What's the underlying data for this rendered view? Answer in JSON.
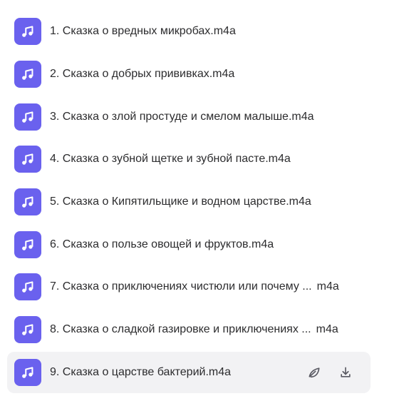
{
  "colors": {
    "icon_background": "#6a61ee",
    "selected_row_background": "#f2f2f4",
    "text": "#2c2c2e",
    "action_icon": "#5a5a63"
  },
  "files": [
    {
      "base": "1. Сказка о вредных микробах",
      "ext": ".m4a",
      "truncated": false
    },
    {
      "base": "2. Сказка о добрых прививках",
      "ext": ".m4a",
      "truncated": false
    },
    {
      "base": "3. Сказка о злой простуде и смелом малыше",
      "ext": ".m4a",
      "truncated": false
    },
    {
      "base": "4. Сказка о зубной щетке и зубной пасте",
      "ext": ".m4a",
      "truncated": false
    },
    {
      "base": "5. Сказка о Кипятильщике и водном царстве",
      "ext": ".m4a",
      "truncated": false
    },
    {
      "base": "6. Сказка о пользе овощей и фруктов",
      "ext": ".m4a",
      "truncated": false
    },
    {
      "base": "7. Сказка о приключениях чистюли или почему ...",
      "ext": "m4a",
      "truncated": true
    },
    {
      "base": "8. Сказка о сладкой газировке и приключениях ...",
      "ext": "m4a",
      "truncated": true
    },
    {
      "base": "9. Сказка о царстве бактерий",
      "ext": ".m4a",
      "truncated": false,
      "selected": true,
      "actions": [
        {
          "name": "leaf-icon"
        },
        {
          "name": "download-icon"
        }
      ]
    }
  ]
}
